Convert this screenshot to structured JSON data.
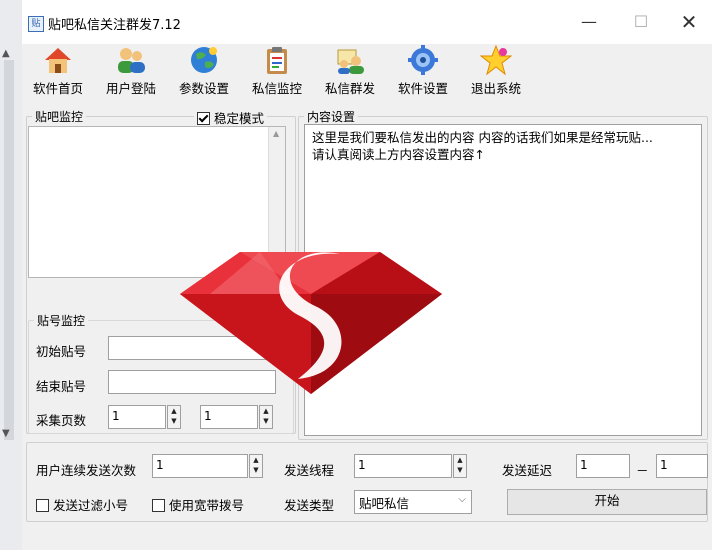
{
  "window": {
    "title": "贴吧私信关注群发7.12",
    "app_icon_text": "贴"
  },
  "toolbar": [
    {
      "label": "软件首页",
      "icon": "home-icon"
    },
    {
      "label": "用户登陆",
      "icon": "users-icon"
    },
    {
      "label": "参数设置",
      "icon": "globe-icon"
    },
    {
      "label": "私信监控",
      "icon": "clipboard-icon"
    },
    {
      "label": "私信群发",
      "icon": "send-users-icon"
    },
    {
      "label": "软件设置",
      "icon": "settings-icon"
    },
    {
      "label": "退出系统",
      "icon": "star-exit-icon"
    }
  ],
  "tieba_monitor": {
    "legend": "贴吧监控",
    "stable_mode_label": "稳定模式",
    "stable_mode_checked": true
  },
  "post_monitor": {
    "legend": "贴号监控",
    "start_label": "初始贴号",
    "start_value": "",
    "end_label": "结束贴号",
    "end_value": "",
    "pages_label": "采集页数",
    "pages_value_1": "1",
    "pages_value_2": "1"
  },
  "content_settings": {
    "legend": "内容设置",
    "text": "这里是我们要私信发出的内容 内容的话我们如果是经常玩贴...\n请认真阅读上方内容设置内容↑"
  },
  "bottom": {
    "consecutive_label": "用户连续发送次数",
    "consecutive_value": "1",
    "threads_label": "发送线程",
    "threads_value": "1",
    "delay_label": "发送延迟",
    "delay_min": "1",
    "delay_dash": "－",
    "delay_max": "1",
    "filter_label": "发送过滤小号",
    "filter_checked": false,
    "broadband_label": "使用宽带拨号",
    "broadband_checked": false,
    "type_label": "发送类型",
    "type_value": "贴吧私信",
    "start_button": "开始"
  },
  "colors": {
    "ruby": "#d4161d",
    "logo_s": "#ffffff"
  }
}
